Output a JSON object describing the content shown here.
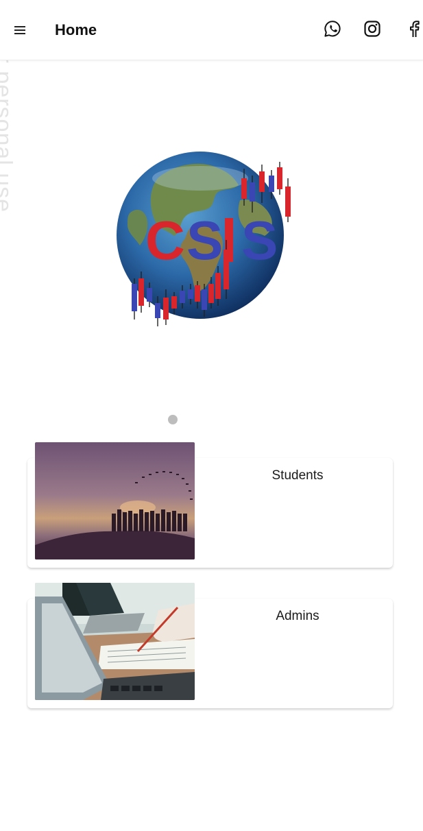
{
  "watermark": "ee for personal use",
  "header": {
    "title": "Home",
    "menu_icon": "hamburger-menu-icon",
    "social_icons": [
      "whatsapp-icon",
      "instagram-icon",
      "facebook-icon"
    ]
  },
  "carousel": {
    "logo_text": "CSIS",
    "slide_count": 1,
    "active_index": 0
  },
  "cards": [
    {
      "label": "Students",
      "image": "graduation-silhouette-sunset"
    },
    {
      "label": "Admins",
      "image": "laptop-desk-writing"
    }
  ],
  "colors": {
    "app_bar": "#ffffff",
    "text": "#111111",
    "dot_inactive": "#bdbdbd",
    "logo_red": "#d9262c",
    "logo_blue": "#3a46b4"
  }
}
